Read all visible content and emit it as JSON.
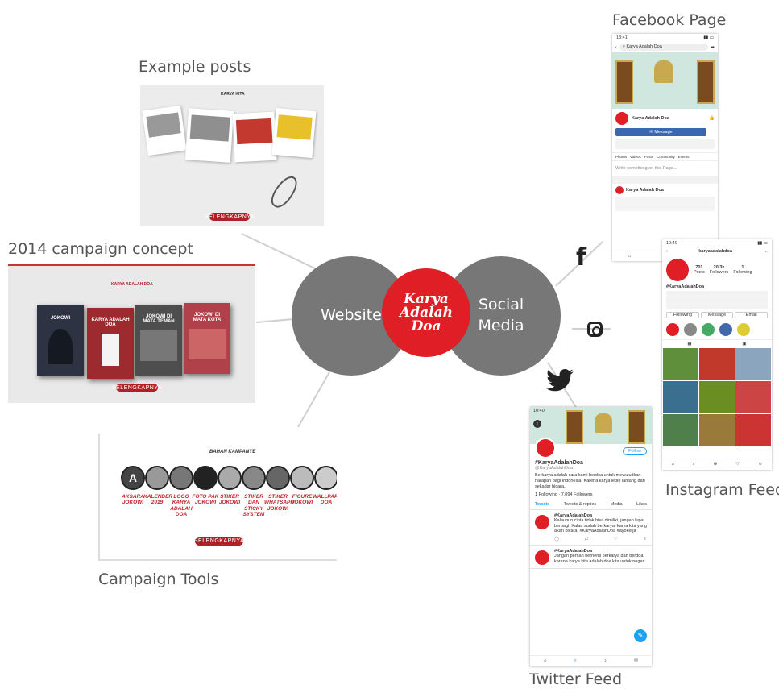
{
  "labels": {
    "facebook_page": "Facebook Page",
    "example_posts": "Example posts",
    "campaign_concept": "2014 campaign concept",
    "campaign_tools": "Campaign Tools",
    "instagram_feed": "Instagram Feed",
    "twitter_feed": "Twitter Feed"
  },
  "hubs": {
    "website": "Website",
    "social_media": "Social Media",
    "logo": "Karya Adalah Doa"
  },
  "colors": {
    "accent": "#e01e25",
    "hub": "#777777",
    "button": "#b11f27"
  },
  "example_posts": {
    "header": "KARYA KITA",
    "button": "SELENGKAPNYA"
  },
  "concept": {
    "header": "KARYA ADALAH DOA",
    "covers": [
      "JOKOWI",
      "KARYA ADALAH DOA",
      "JOKOWI DI MATA TEMAN",
      "JOKOWI DI MATA KOTA"
    ],
    "button": "SELENGKAPNYA"
  },
  "tools": {
    "header": "BAHAN KAMPANYE",
    "items": [
      "AKSARA JOKOWI",
      "KALENDER 2019",
      "LOGO KARYA ADALAH DOA",
      "FOTO PAK JOKOWI",
      "STIKER JOKOWI",
      "STIKER DAN STICKY SYSTEM",
      "STIKER WHATSAPP JOKOWI",
      "FIGURE JOKOWI",
      "WALLPAPER DOA"
    ],
    "button": "SELENGKAPNYA"
  },
  "facebook": {
    "time": "13:41",
    "search": "Karya Adalah Doa",
    "page_name": "Karya Adalah Doa",
    "message_button": "Message",
    "tabs": [
      "Photos",
      "Videos",
      "Posts",
      "Community",
      "Events"
    ],
    "composer": "Write something on this Page...",
    "post_author": "Karya Adalah Doa"
  },
  "instagram": {
    "time": "10:40",
    "username": "karyaadalahdoa",
    "posts": "701",
    "posts_label": "Posts",
    "followers": "20.3k",
    "followers_label": "Followers",
    "following": "1",
    "following_label": "Following",
    "name": "#KaryaAdalahDoa",
    "buttons": [
      "Following",
      "Message",
      "Email"
    ]
  },
  "twitter": {
    "time": "10:40",
    "name": "#KaryaAdalahDoa",
    "handle": "@KaryaAdalahDoa",
    "follow": "Follow",
    "bio": "Berkarya adalah cara kami berdoa untuk mewujudkan harapan bagi Indonesia. Karena karya lebih lantang dari sekadar bicara.",
    "following": "1 Following",
    "followers": "7,094 Followers",
    "tabs": [
      "Tweets",
      "Tweets & replies",
      "Media",
      "Likes"
    ],
    "tweets": [
      {
        "author": "#KaryaAdalahDoa",
        "text": "Kalaupun cinta tidak bisa dimiliki, jangan lupa berbagi. Kalau sudah berkarya, karya kita yang akan bicara. #KaryaAdalahDoa #ayokerja"
      },
      {
        "author": "#KaryaAdalahDoa",
        "text": "Jangan pernah berhenti berkarya dan berdoa, karena karya kita adalah doa kita untuk negeri."
      }
    ]
  }
}
